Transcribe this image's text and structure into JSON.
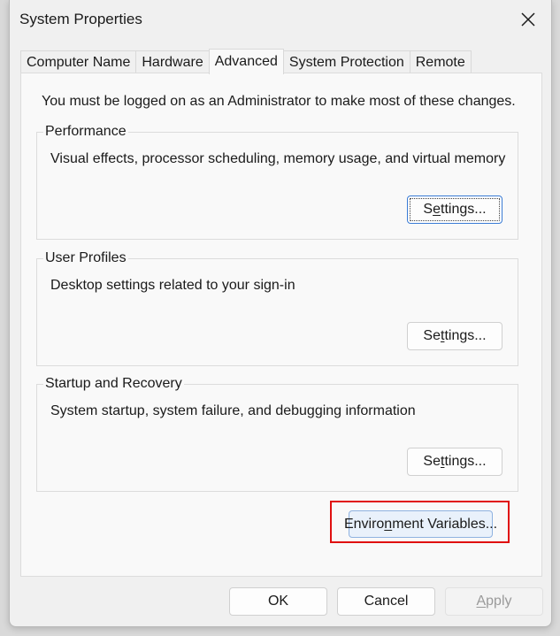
{
  "window": {
    "title": "System Properties",
    "close_icon": "close-icon"
  },
  "tabs": [
    {
      "label": "Computer Name",
      "active": false
    },
    {
      "label": "Hardware",
      "active": false
    },
    {
      "label": "Advanced",
      "active": true
    },
    {
      "label": "System Protection",
      "active": false
    },
    {
      "label": "Remote",
      "active": false
    }
  ],
  "advanced": {
    "admin_note": "You must be logged on as an Administrator to make most of these changes.",
    "performance": {
      "legend": "Performance",
      "description": "Visual effects, processor scheduling, memory usage, and virtual memory",
      "settings_pre": "S",
      "settings_mnemonic": "e",
      "settings_post": "ttings..."
    },
    "user_profiles": {
      "legend": "User Profiles",
      "description": "Desktop settings related to your sign-in",
      "settings_pre": "Se",
      "settings_mnemonic": "t",
      "settings_post": "tings..."
    },
    "startup_recovery": {
      "legend": "Startup and Recovery",
      "description": "System startup, system failure, and debugging information",
      "settings_pre": "Se",
      "settings_mnemonic": "t",
      "settings_post": "tings..."
    },
    "env_vars": {
      "pre": "Enviro",
      "mnemonic": "n",
      "post": "ment Variables..."
    }
  },
  "footer": {
    "ok": "OK",
    "cancel": "Cancel",
    "apply_mnemonic": "A",
    "apply_post": "pply"
  },
  "colors": {
    "highlight": "#e01010",
    "focus": "#3a7bd5"
  }
}
